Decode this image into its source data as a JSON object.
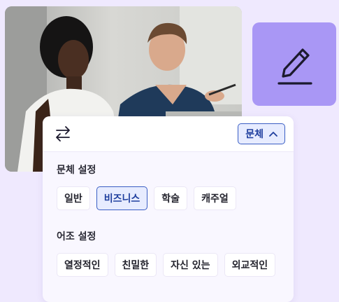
{
  "photo": {
    "description_icon": "photo-two-people-meeting"
  },
  "edit_tile": {
    "icon": "pencil-edit-icon",
    "color": "#a997f5"
  },
  "popup": {
    "swap_icon": "swap-arrows-icon",
    "dropdown": {
      "label": "문체",
      "icon": "chevron-up-icon"
    },
    "style_section": {
      "title": "문체 설정",
      "options": [
        "일반",
        "비즈니스",
        "학술",
        "캐주얼"
      ],
      "selected": "비즈니스"
    },
    "tone_section": {
      "title": "어조 설정",
      "options": [
        "열정적인",
        "친밀한",
        "자신 있는",
        "외교적인"
      ],
      "selected": null
    }
  },
  "colors": {
    "background": "#efe9fe",
    "accent": "#3a5ec4",
    "selected_bg": "#e7ecff",
    "tile": "#a997f5"
  }
}
